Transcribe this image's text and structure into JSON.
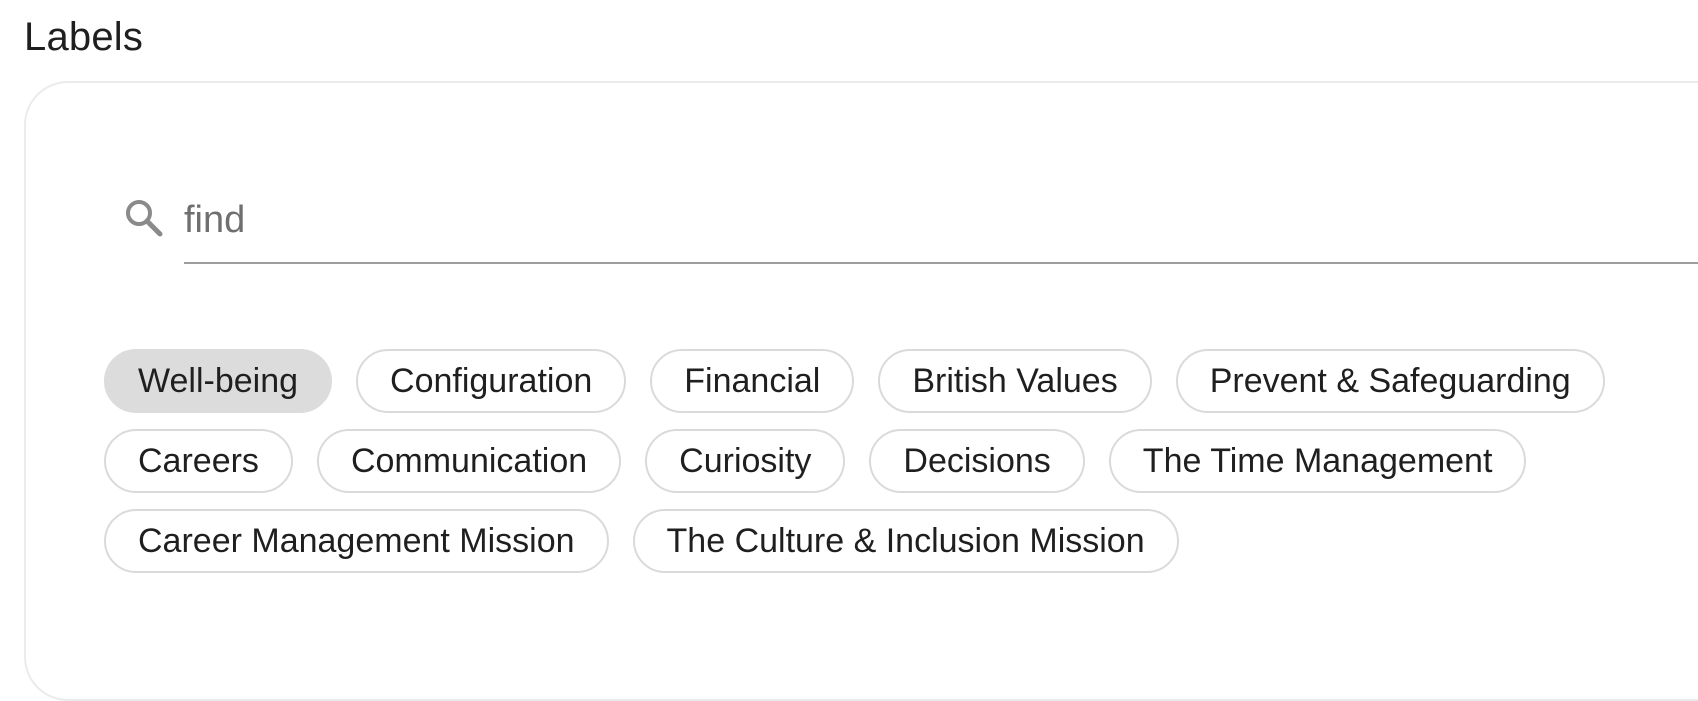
{
  "header": {
    "title": "Labels"
  },
  "search": {
    "value": "find",
    "icon": "search-icon"
  },
  "labels": {
    "selected": "Well-being",
    "rows": [
      [
        "Well-being",
        "Configuration",
        "Financial",
        "British Values",
        "Prevent & Safeguarding"
      ],
      [
        "Careers",
        "Communication",
        "Curiosity",
        "Decisions",
        "The Time Management"
      ],
      [
        "Career Management Mission",
        "The Culture & Inclusion Mission"
      ]
    ]
  },
  "colors": {
    "selected_chip_bg": "#dcdcdc",
    "chip_border": "#dadada",
    "input_underline": "#9e9e9e"
  }
}
